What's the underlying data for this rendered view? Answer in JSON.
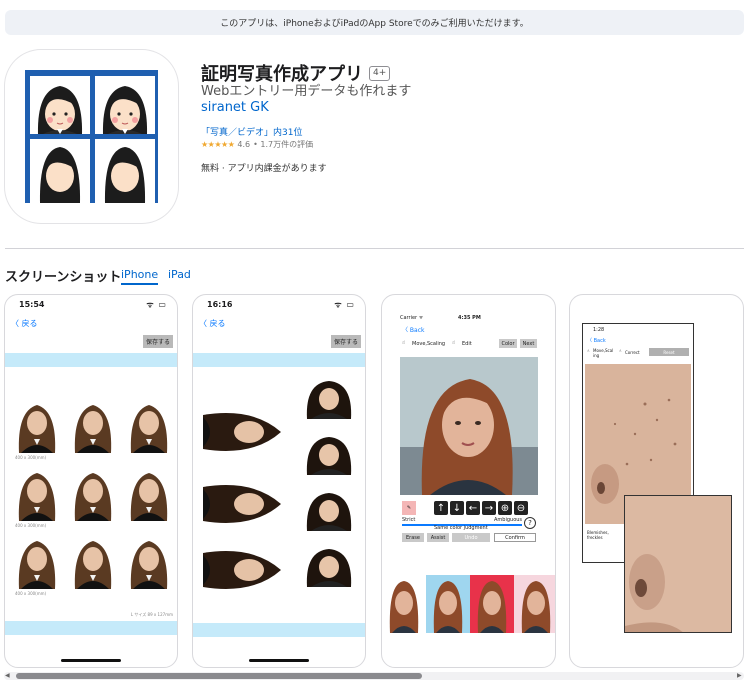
{
  "banner": {
    "text": "このアプリは、iPhoneおよびiPadのApp Storeでのみご利用いただけます。"
  },
  "app": {
    "title": "証明写真作成アプリ",
    "age_rating": "4+",
    "subtitle": "Webエントリー用データも作れます",
    "developer": "siranet GK",
    "rank": "「写真／ビデオ」内31位",
    "stars": "★★★★★",
    "rating": "4.6",
    "rating_count": "• 1.7万件の評価",
    "price": "無料 · アプリ内課金があります"
  },
  "screenshots": {
    "section_title": "スクリーンショット",
    "tabs": [
      {
        "label": "iPhone"
      },
      {
        "label": "iPad"
      }
    ],
    "shot1": {
      "time": "15:54",
      "back": "〈 戻る",
      "save": "保存する",
      "caption": "400 x 300(mm)",
      "footer": "L サイズ 89 x 127mm"
    },
    "shot2": {
      "time": "16:16",
      "back": "〈 戻る",
      "save": "保存する"
    },
    "shot3": {
      "carrier": "Carrier ᯤ",
      "time": "4:35 PM",
      "back": "〈 Back",
      "move_scaling": "Move,Scaling",
      "edit": "Edit",
      "color": "Color",
      "next": "Next",
      "strict": "Strict",
      "ambiguous": "Ambiguous",
      "same_color": "Same color judgment",
      "erase": "Erase",
      "assist": "Assist",
      "undo": "Undo",
      "confirm": "Confirm"
    },
    "shot4": {
      "time": "1:28",
      "back": "〈 Back",
      "move_scaling": "Move,Scal ing",
      "correct": "Correct",
      "reset": "Reset",
      "blemish": "Blemishes, freckles"
    }
  },
  "icons": {
    "wifi": "wifi-icon",
    "battery": "battery-icon",
    "hand": "hand-pointer-icon"
  }
}
